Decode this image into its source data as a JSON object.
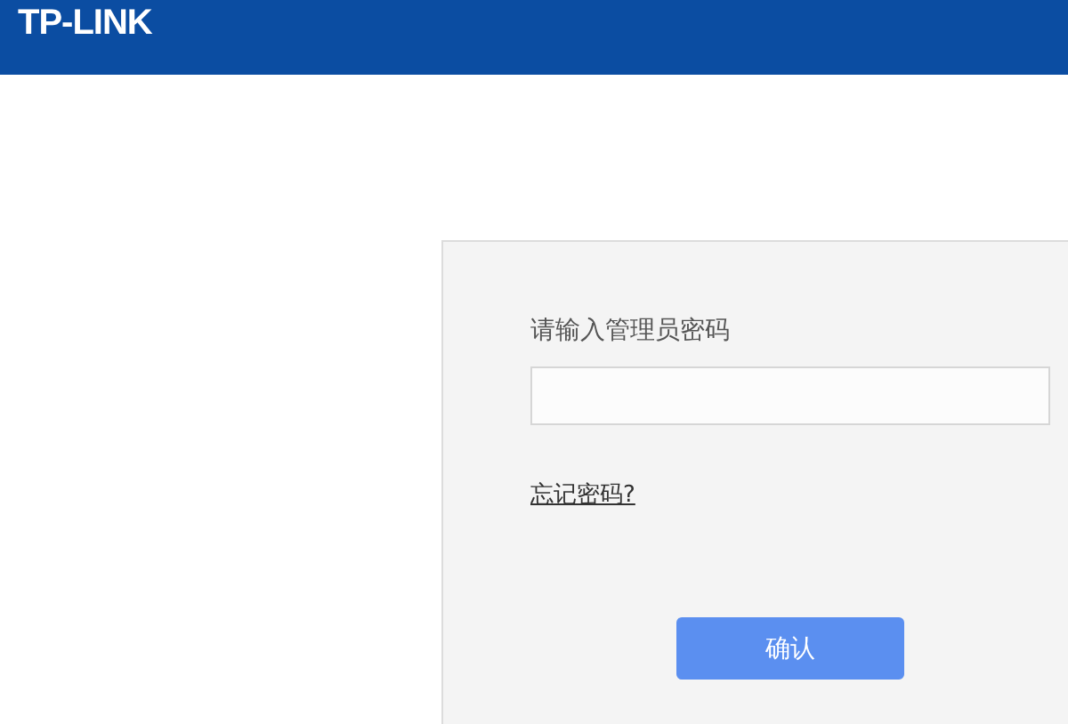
{
  "header": {
    "logo": "TP-LINK"
  },
  "login": {
    "label": "请输入管理员密码",
    "forgot_link": "忘记密码?",
    "confirm_button": "确认"
  }
}
